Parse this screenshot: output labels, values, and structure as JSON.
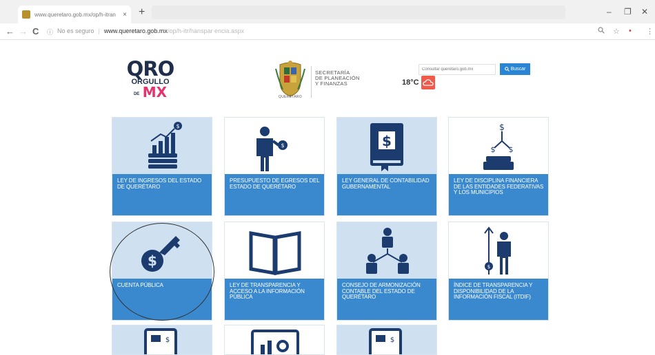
{
  "browser": {
    "tab_title": "www.queretaro.gob.mx/op/h-itran",
    "tab_close": "×",
    "new_tab": "+",
    "security": "No es seguro",
    "url_host": "www.queretaro.gob.mx",
    "url_path": "/op/h-itr/hanspar encia.aspx",
    "back": "←",
    "forward": "→",
    "reload": "C",
    "info_icon": "ⓘ",
    "minimize": "–",
    "restore": "❐",
    "close": "✕",
    "zoom_icon": "🔍",
    "star_icon": "☆",
    "menu_icon": "⋮"
  },
  "header": {
    "logo_line1": "QRO",
    "logo_line2": "ORGULLO",
    "logo_de": "DE",
    "logo_mx": "MX",
    "seal_caption": "QUERÉTARO",
    "secretaria": [
      "SECRETARÍA",
      "DE PLANEACIÓN",
      "Y FINANZAS"
    ],
    "search_placeholder": "Consultar queretaro.gob.mx",
    "search_button": "Buscar",
    "temperature": "18°C"
  },
  "tiles": [
    {
      "label": "LEY DE INGRESOS DEL ESTADO DE QUERÉTARO",
      "icon": "growth-chart-icon"
    },
    {
      "label": "PRESUPUESTO DE EGRESOS DEL ESTADO DE QUERÉTARO",
      "icon": "businessman-coin-icon"
    },
    {
      "label": "LEY GENERAL DE CONTABILIDAD GUBERNAMENTAL",
      "icon": "dollar-book-icon"
    },
    {
      "label": "LEY DE DISCIPLINA FINANCIERA DE LAS ENTIDADES FEDERATIVAS Y LOS MUNICIPIOS",
      "icon": "money-tree-icon"
    },
    {
      "label": "CUENTA PÚBLICA",
      "icon": "dollar-key-icon"
    },
    {
      "label": "LEY DE TRANSPARENCIA Y ACCESO A LA INFORMACIÓN PÚBLICA",
      "icon": "open-book-icon"
    },
    {
      "label": "CONSEJO DE ARMONIZACIÓN CONTABLE DEL ESTADO DE QUERÉTARO",
      "icon": "people-network-icon"
    },
    {
      "label": "ÍNDICE DE TRANSPARENCIA Y DISPONIBILIDAD DE LA INFORMACIÓN FISCAL (ITDIF)",
      "icon": "businessman-arrow-icon"
    }
  ],
  "colors": {
    "tile_caption": "#3a89cf",
    "tile_illustration": "#cfe1f1",
    "icon_navy": "#1c3b6e",
    "logo_magenta": "#e4336d",
    "search_button": "#2a86d4"
  }
}
